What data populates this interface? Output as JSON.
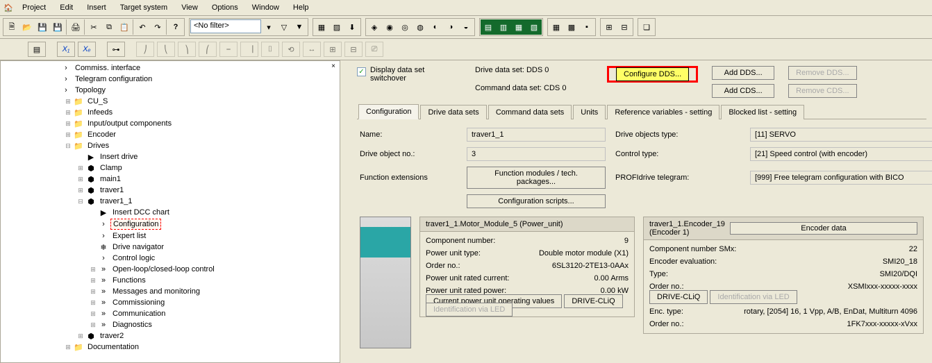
{
  "menu": {
    "items": [
      "Project",
      "Edit",
      "Insert",
      "Target system",
      "View",
      "Options",
      "Window",
      "Help"
    ]
  },
  "toolbar": {
    "filter_label": "<No filter>"
  },
  "tree": {
    "items": [
      {
        "label": "Commiss. interface",
        "indent": 1,
        "icon": "arrow"
      },
      {
        "label": "Telegram configuration",
        "indent": 1,
        "icon": "arrow"
      },
      {
        "label": "Topology",
        "indent": 1,
        "icon": "arrow"
      },
      {
        "label": "CU_S",
        "indent": 2,
        "icon": "folder",
        "exp": "+"
      },
      {
        "label": "Infeeds",
        "indent": 2,
        "icon": "folder",
        "exp": "+"
      },
      {
        "label": "Input/output components",
        "indent": 2,
        "icon": "folder",
        "exp": "+"
      },
      {
        "label": "Encoder",
        "indent": 2,
        "icon": "folder",
        "exp": "+"
      },
      {
        "label": "Drives",
        "indent": 2,
        "icon": "folder",
        "exp": "−"
      },
      {
        "label": "Insert drive",
        "indent": 3,
        "icon": "insert"
      },
      {
        "label": "Clamp",
        "indent": 3,
        "icon": "drive",
        "exp": "+"
      },
      {
        "label": "main1",
        "indent": 3,
        "icon": "drive",
        "exp": "+"
      },
      {
        "label": "traver1",
        "indent": 3,
        "icon": "drive",
        "exp": "+"
      },
      {
        "label": "traver1_1",
        "indent": 3,
        "icon": "drive",
        "exp": "−"
      },
      {
        "label": "Insert DCC chart",
        "indent": 4,
        "icon": "chart"
      },
      {
        "label": "Configuration",
        "indent": 4,
        "icon": "arrow",
        "selected": true
      },
      {
        "label": "Expert list",
        "indent": 4,
        "icon": "arrow"
      },
      {
        "label": "Drive navigator",
        "indent": 4,
        "icon": "gear"
      },
      {
        "label": "Control logic",
        "indent": 4,
        "icon": "arrow"
      },
      {
        "label": "Open-loop/closed-loop control",
        "indent": 4,
        "icon": "dblarrow",
        "exp": "+"
      },
      {
        "label": "Functions",
        "indent": 4,
        "icon": "dblarrow",
        "exp": "+"
      },
      {
        "label": "Messages and monitoring",
        "indent": 4,
        "icon": "dblarrow",
        "exp": "+"
      },
      {
        "label": "Commissioning",
        "indent": 4,
        "icon": "dblarrow",
        "exp": "+"
      },
      {
        "label": "Communication",
        "indent": 4,
        "icon": "dblarrow",
        "exp": "+"
      },
      {
        "label": "Diagnostics",
        "indent": 4,
        "icon": "dblarrow",
        "exp": "+"
      },
      {
        "label": "traver2",
        "indent": 3,
        "icon": "drive",
        "exp": "+"
      },
      {
        "label": "Documentation",
        "indent": 2,
        "icon": "folder",
        "exp": "+"
      }
    ]
  },
  "dds": {
    "display_checkbox_label": "Display data set\nswitchover",
    "drive_label": "Drive data set: DDS 0",
    "command_label": "Command data set: CDS 0",
    "configure_btn": "Configure DDS...",
    "add_dds_btn": "Add DDS...",
    "remove_dds_btn": "Remove DDS...",
    "add_cds_btn": "Add CDS...",
    "remove_cds_btn": "Remove CDS..."
  },
  "tabs": [
    "Configuration",
    "Drive data sets",
    "Command data sets",
    "Units",
    "Reference variables - setting",
    "Blocked list - setting"
  ],
  "config": {
    "name_l": "Name:",
    "name_v": "traver1_1",
    "objtype_l": "Drive objects type:",
    "objtype_v": "[11] SERVO",
    "objno_l": "Drive object no.:",
    "objno_v": "3",
    "ctrl_l": "Control type:",
    "ctrl_v": "[21] Speed control (with encoder)",
    "funcext_l": "Function extensions",
    "funcext_btn": "Function modules / tech. packages...",
    "telegram_l": "PROFIdrive telegram:",
    "telegram_v": "[999] Free telegram configuration with BICO",
    "cfgscripts_btn": "Configuration scripts..."
  },
  "power": {
    "title": "traver1_1.Motor_Module_5 (Power_unit)",
    "compno_l": "Component number:",
    "compno_v": "9",
    "putype_l": "Power unit type:",
    "putype_v": "Double motor module (X1)",
    "orderno_l": "Order no.:",
    "orderno_v": "6SL3120-2TE13-0AAx",
    "current_l": "Power unit rated current:",
    "current_v": "0.00 Arms",
    "power_l": "Power unit rated power:",
    "power_v": "0.00 kW",
    "opvals_btn": "Current power unit operating values",
    "drivecliq_btn": "DRIVE-CLiQ",
    "led_btn": "Identification via LED"
  },
  "encoder": {
    "title": "traver1_1.Encoder_19 (Encoder 1)",
    "encdata_btn": "Encoder data",
    "compsmx_l": "Component number SMx:",
    "compsmx_v": "22",
    "eval_l": "Encoder evaluation:",
    "eval_v": "SMI20_18",
    "type_l": "Type:",
    "type_v": "SMI20/DQI",
    "orderno_l": "Order no.:",
    "orderno_v": "XSMIxxx-xxxxx-xxxx",
    "drivecliq_btn": "DRIVE-CLiQ",
    "led_btn": "Identification via LED",
    "enctype_l": "Enc. type:",
    "enctype_v": "rotary, [2054] 16, 1 Vpp, A/B, EnDat, Multiturn 4096",
    "orderno2_l": "Order no.:",
    "orderno2_v": "1FK7xxx-xxxxx-xVxx"
  }
}
